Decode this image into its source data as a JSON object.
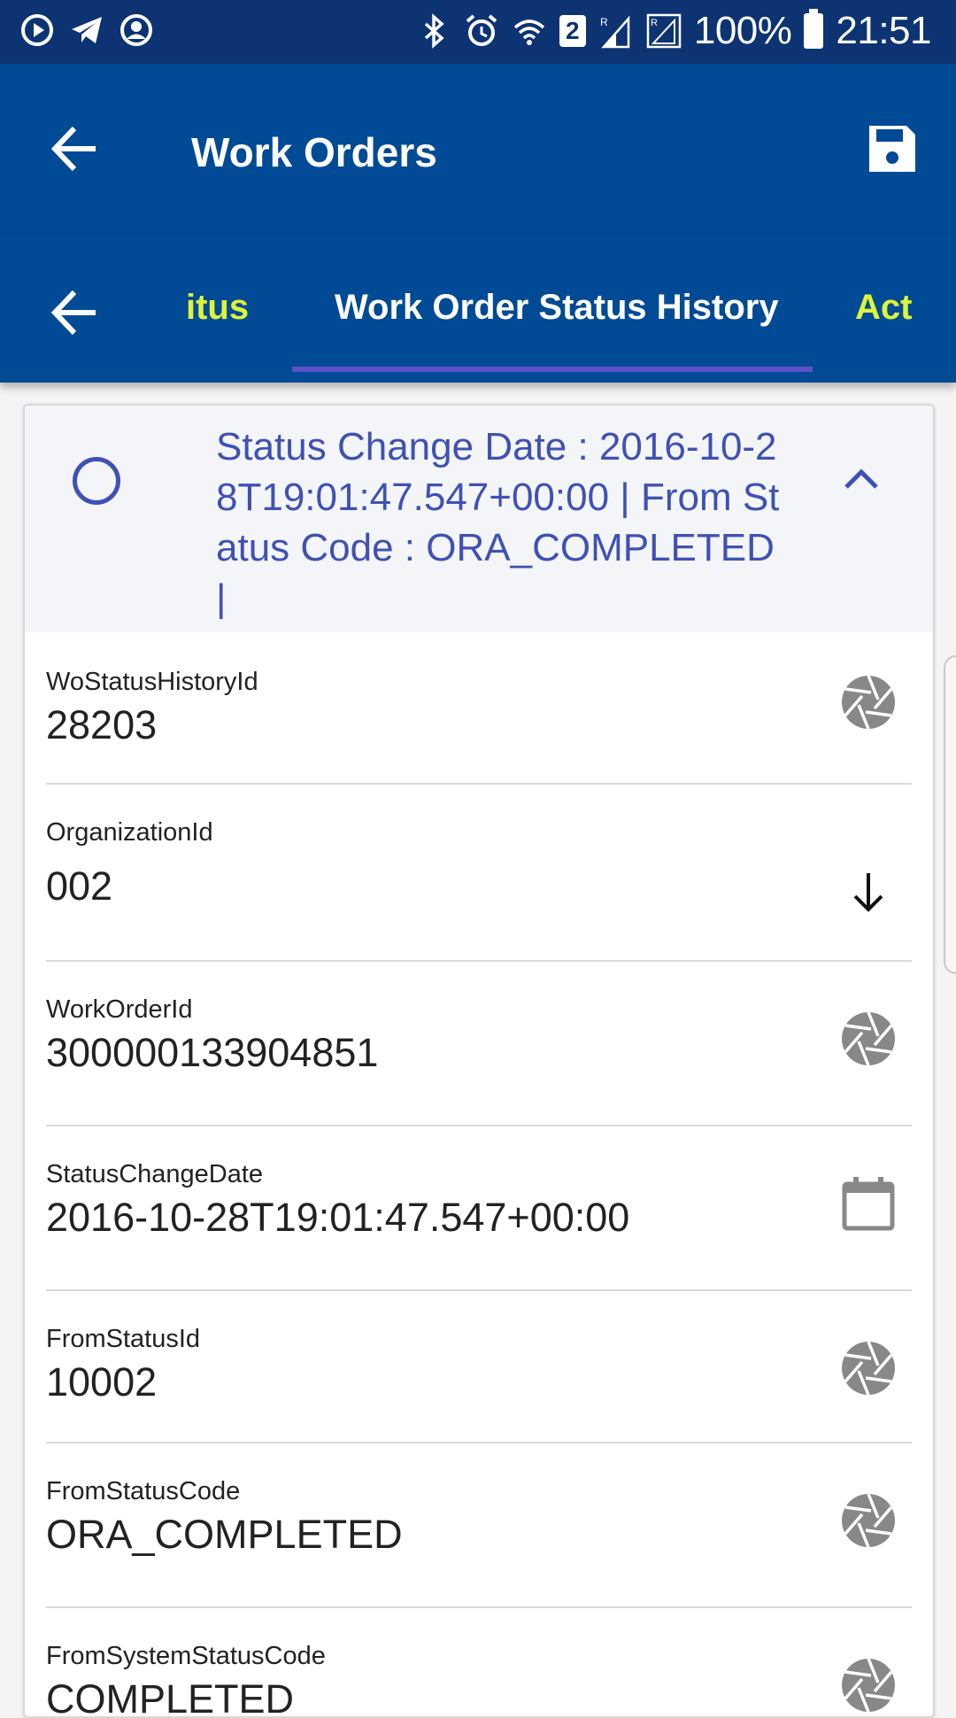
{
  "status_bar": {
    "battery_text": "100%",
    "time": "21:51",
    "sim_badge": "2"
  },
  "app_bar": {
    "title": "Work Orders"
  },
  "tabs": [
    {
      "label": "Work Order Status"
    },
    {
      "label": "Work Order Status History"
    },
    {
      "label": "Act"
    }
  ],
  "tab_left_partial": "itus",
  "card": {
    "header_text": "Status Change Date : 2016-10-28T19:01:47.547+00:00 | From Status Code : ORA_COMPLETED |",
    "fields": [
      {
        "label": "WoStatusHistoryId",
        "value": "28203",
        "icon": "aperture-icon"
      },
      {
        "label": "OrganizationId",
        "value": "002",
        "icon": "arrow-down-icon"
      },
      {
        "label": "WorkOrderId",
        "value": "300000133904851",
        "icon": "aperture-icon"
      },
      {
        "label": "StatusChangeDate",
        "value": "2016-10-28T19:01:47.547+00:00",
        "icon": "calendar-icon"
      },
      {
        "label": "FromStatusId",
        "value": "10002",
        "icon": "aperture-icon"
      },
      {
        "label": "FromStatusCode",
        "value": "ORA_COMPLETED",
        "icon": "aperture-icon"
      },
      {
        "label": "FromSystemStatusCode",
        "value": "COMPLETED",
        "icon": "aperture-icon"
      }
    ]
  },
  "colors": {
    "status_bar": "#0d3373",
    "app_bar": "#014a95",
    "tab_inactive": "#ddf43a",
    "accent": "#3f51b5",
    "icon_gray": "#888888"
  }
}
